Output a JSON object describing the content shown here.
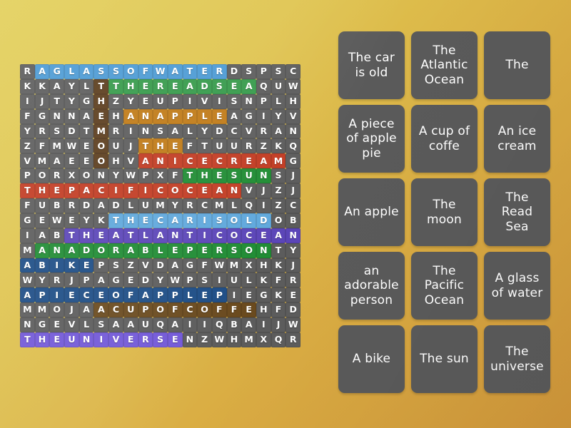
{
  "app": {
    "type": "word-search-puzzle",
    "background_start_color": "#e2cf58",
    "background_end_color": "#d0963a",
    "card_color": "#5a5a5a",
    "cell_color": "#5c5c5c"
  },
  "grid": {
    "columns": 20,
    "rows": 20,
    "letters": [
      [
        "R",
        "A",
        "G",
        "L",
        "A",
        "S",
        "S",
        "O",
        "F",
        "W",
        "A",
        "T",
        "E",
        "R",
        "D",
        "S",
        "P",
        "S",
        "C",
        ""
      ],
      [
        "K",
        "K",
        "A",
        "Y",
        "L",
        "T",
        "T",
        "H",
        "E",
        "R",
        "E",
        "A",
        "D",
        "S",
        "E",
        "A",
        "Q",
        "U",
        "W",
        ""
      ],
      [
        "I",
        "J",
        "T",
        "Y",
        "G",
        "H",
        "Z",
        "Y",
        "E",
        "U",
        "P",
        "I",
        "V",
        "I",
        "S",
        "N",
        "P",
        "L",
        "H",
        ""
      ],
      [
        "F",
        "G",
        "N",
        "N",
        "A",
        "E",
        "H",
        "A",
        "N",
        "A",
        "P",
        "P",
        "L",
        "E",
        "A",
        "G",
        "I",
        "Y",
        "V",
        ""
      ],
      [
        "Y",
        "R",
        "S",
        "D",
        "T",
        "M",
        "R",
        "I",
        "N",
        "S",
        "A",
        "L",
        "Y",
        "D",
        "C",
        "V",
        "R",
        "A",
        "N",
        ""
      ],
      [
        "Z",
        "F",
        "M",
        "W",
        "E",
        "O",
        "U",
        "J",
        "T",
        "H",
        "E",
        "F",
        "T",
        "U",
        "U",
        "R",
        "Z",
        "K",
        "Q",
        ""
      ],
      [
        "V",
        "M",
        "A",
        "E",
        "E",
        "O",
        "H",
        "V",
        "A",
        "N",
        "I",
        "C",
        "E",
        "C",
        "R",
        "E",
        "A",
        "M",
        "G",
        ""
      ],
      [
        "P",
        "O",
        "R",
        "X",
        "O",
        "N",
        "Y",
        "W",
        "P",
        "X",
        "F",
        "T",
        "H",
        "E",
        "S",
        "U",
        "N",
        "S",
        "J",
        ""
      ],
      [
        "T",
        "H",
        "E",
        "P",
        "A",
        "C",
        "I",
        "F",
        "I",
        "C",
        "O",
        "C",
        "E",
        "A",
        "N",
        "V",
        "J",
        "Z",
        "J",
        ""
      ],
      [
        "F",
        "U",
        "B",
        "R",
        "D",
        "A",
        "D",
        "L",
        "U",
        "M",
        "Y",
        "R",
        "C",
        "M",
        "L",
        "Q",
        "I",
        "Z",
        "C",
        ""
      ],
      [
        "G",
        "E",
        "W",
        "E",
        "Y",
        "K",
        "T",
        "H",
        "E",
        "C",
        "A",
        "R",
        "I",
        "S",
        "O",
        "L",
        "D",
        "O",
        "B",
        ""
      ],
      [
        "I",
        "A",
        "B",
        "T",
        "H",
        "E",
        "A",
        "T",
        "L",
        "A",
        "N",
        "T",
        "I",
        "C",
        "O",
        "C",
        "E",
        "A",
        "N",
        ""
      ],
      [
        "M",
        "A",
        "N",
        "A",
        "D",
        "O",
        "R",
        "A",
        "B",
        "L",
        "E",
        "P",
        "E",
        "R",
        "S",
        "O",
        "N",
        "T",
        "Y",
        ""
      ],
      [
        "A",
        "B",
        "I",
        "K",
        "E",
        "P",
        "S",
        "Z",
        "V",
        "D",
        "A",
        "G",
        "F",
        "W",
        "M",
        "X",
        "H",
        "K",
        "J",
        ""
      ],
      [
        "W",
        "Y",
        "R",
        "J",
        "P",
        "A",
        "G",
        "E",
        "D",
        "Y",
        "W",
        "P",
        "S",
        "I",
        "U",
        "L",
        "K",
        "F",
        "R",
        ""
      ],
      [
        "A",
        "P",
        "I",
        "E",
        "C",
        "E",
        "O",
        "F",
        "A",
        "P",
        "P",
        "L",
        "E",
        "P",
        "I",
        "E",
        "G",
        "K",
        "E",
        ""
      ],
      [
        "M",
        "M",
        "O",
        "J",
        "A",
        "A",
        "C",
        "U",
        "P",
        "O",
        "F",
        "C",
        "O",
        "F",
        "F",
        "E",
        "H",
        "F",
        "D",
        ""
      ],
      [
        "N",
        "G",
        "E",
        "V",
        "L",
        "S",
        "A",
        "A",
        "U",
        "Q",
        "A",
        "I",
        "I",
        "Q",
        "B",
        "A",
        "I",
        "J",
        "W",
        ""
      ],
      [
        "T",
        "H",
        "E",
        "U",
        "N",
        "I",
        "V",
        "E",
        "R",
        "S",
        "E",
        "N",
        "Z",
        "W",
        "H",
        "M",
        "X",
        "Q",
        "R",
        ""
      ],
      [
        "",
        "",
        "",
        "",
        "",
        "",
        "",
        "",
        "",
        "",
        "",
        "",
        "",
        "",
        "",
        "",
        "",
        "",
        "",
        ""
      ]
    ],
    "highlights": [
      {
        "word": "A GLASS OF WATER",
        "color_class": "hl-blue",
        "row": 0,
        "col_start": 1,
        "col_end": 13
      },
      {
        "word": "THE READ SEA",
        "color_class": "hl-green",
        "row": 1,
        "col_start": 6,
        "col_end": 15
      },
      {
        "word": "AN APPLE",
        "color_class": "hl-orange",
        "row": 3,
        "col_start": 7,
        "col_end": 13
      },
      {
        "word": "THE",
        "color_class": "hl-orange",
        "row": 5,
        "col_start": 8,
        "col_end": 10
      },
      {
        "word": "AN ICE CREAM",
        "color_class": "hl-red",
        "row": 6,
        "col_start": 8,
        "col_end": 17
      },
      {
        "word": "THE SUN",
        "color_class": "hl-dkgreen",
        "row": 7,
        "col_start": 11,
        "col_end": 16
      },
      {
        "word": "THE PACIFIC OCEAN",
        "color_class": "hl-red",
        "row": 8,
        "col_start": 0,
        "col_end": 14
      },
      {
        "word": "THE CAR IS OLD",
        "color_class": "hl-ltblue",
        "row": 10,
        "col_start": 6,
        "col_end": 16
      },
      {
        "word": "THE ATLANTIC OCEAN",
        "color_class": "hl-purple",
        "row": 11,
        "col_start": 3,
        "col_end": 18
      },
      {
        "word": "AN ADORABLE PERSON",
        "color_class": "hl-dkgreen",
        "row": 12,
        "col_start": 1,
        "col_end": 16
      },
      {
        "word": "A BIKE",
        "color_class": "hl-navy",
        "row": 13,
        "col_start": 0,
        "col_end": 4
      },
      {
        "word": "A PIECE OF APPLE PIE",
        "color_class": "hl-navy",
        "row": 15,
        "col_start": 0,
        "col_end": 13
      },
      {
        "word": "A CUP OF COFFE",
        "color_class": "hl-dkbrown",
        "row": 16,
        "col_start": 5,
        "col_end": 15
      },
      {
        "word": "THE UNIVERSE",
        "color_class": "hl-violet",
        "row": 18,
        "col_start": 0,
        "col_end": 10
      },
      {
        "word": "THE-vertical",
        "color_class": "hl-brown",
        "col": 5,
        "row_start": 1,
        "row_end": 6
      }
    ]
  },
  "cards": [
    {
      "id": "card-the-car-is-old",
      "label": "The car is old"
    },
    {
      "id": "card-the-atlantic-ocean",
      "label": "The Atlantic Ocean"
    },
    {
      "id": "card-the",
      "label": "The"
    },
    {
      "id": "card-a-piece-of-apple-pie",
      "label": "A piece of apple pie"
    },
    {
      "id": "card-a-cup-of-coffe",
      "label": "A cup of coffe"
    },
    {
      "id": "card-an-ice-cream",
      "label": "An ice cream"
    },
    {
      "id": "card-an-apple",
      "label": "An apple"
    },
    {
      "id": "card-the-moon",
      "label": "The moon"
    },
    {
      "id": "card-the-read-sea",
      "label": "The Read Sea"
    },
    {
      "id": "card-an-adorable-person",
      "label": "an adorable person"
    },
    {
      "id": "card-the-pacific-ocean",
      "label": "The Pacific Ocean"
    },
    {
      "id": "card-a-glass-of-water",
      "label": "A glass of water"
    },
    {
      "id": "card-a-bike",
      "label": "A bike"
    },
    {
      "id": "card-the-sun",
      "label": "The sun"
    },
    {
      "id": "card-the-universe",
      "label": "The universe"
    }
  ]
}
